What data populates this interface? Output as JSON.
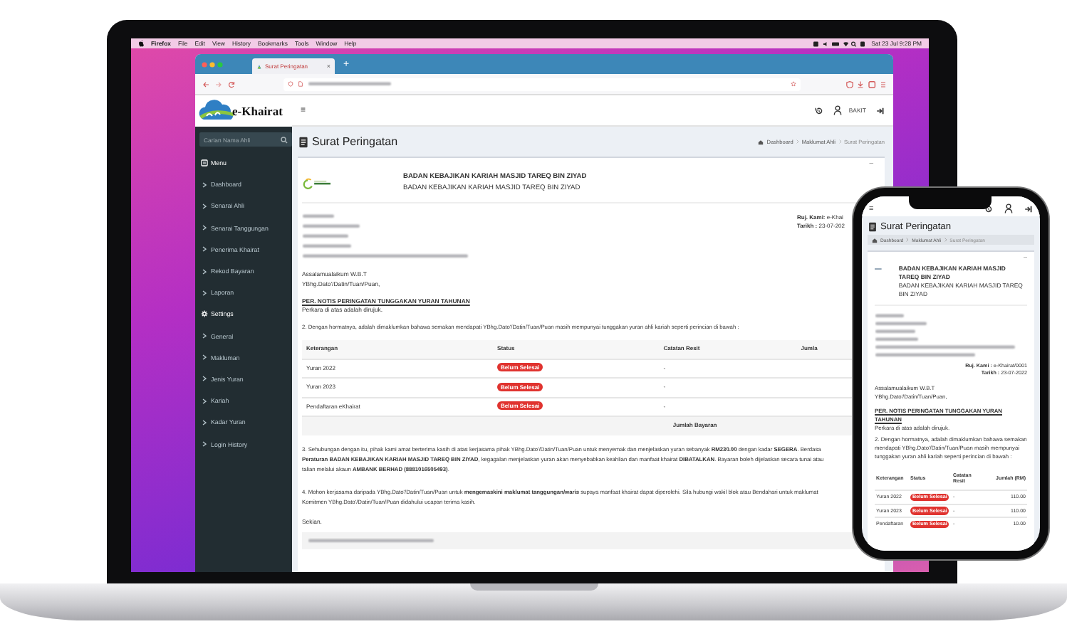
{
  "laptop": {
    "menu_bar": {
      "app": "Firefox",
      "menus": [
        "File",
        "Edit",
        "View",
        "History",
        "Bookmarks",
        "Tools",
        "Window",
        "Help"
      ],
      "clock": "Sat 23 Jul 9:28 PM"
    },
    "browser": {
      "tabs": [
        {
          "label": "Surat Peringatan",
          "selected": true
        }
      ],
      "close_tab": "×",
      "new_tab": "+"
    },
    "app": {
      "logo": "e-Khairat",
      "menu_toggle": "≡",
      "user": "BAKIT",
      "sidebar": {
        "search": {
          "placeholder": "Carian Nama Ahli"
        },
        "items": [
          {
            "kind": "section",
            "label": "Menu"
          },
          {
            "kind": "link",
            "label": "Dashboard"
          },
          {
            "kind": "link",
            "label": "Senarai Ahli"
          },
          {
            "kind": "link",
            "label": "Senarai Tanggungan"
          },
          {
            "kind": "link",
            "label": "Penerima Khairat"
          },
          {
            "kind": "link",
            "label": "Rekod Bayaran"
          },
          {
            "kind": "link",
            "label": "Laporan"
          },
          {
            "kind": "section",
            "label": "Settings"
          },
          {
            "kind": "link",
            "label": "General"
          },
          {
            "kind": "link",
            "label": "Makluman"
          },
          {
            "kind": "link",
            "label": "Jenis Yuran"
          },
          {
            "kind": "link",
            "label": "Kariah"
          },
          {
            "kind": "link",
            "label": "Kadar Yuran"
          },
          {
            "kind": "link",
            "label": "Login History"
          }
        ]
      },
      "page_title": "Surat Peringatan",
      "breadcrumb": [
        "Dashboard",
        "Maklumat Ahli",
        "Surat Peringatan"
      ],
      "collapse": "–",
      "letter": {
        "org_name": "BADAN KEBAJIKAN KARIAH MASJID TAREQ BIN ZIYAD",
        "org_subtitle": "BADAN KEBAJIKAN KARIAH MASJID TAREQ BIN ZIYAD",
        "references": [
          {
            "label": "Ruj. Kami:",
            "value": "e-Khai"
          },
          {
            "label": "Tarikh :",
            "value": "23-07-202"
          }
        ],
        "greeting": [
          "Assalamualaikum W.B.T",
          "YBhg.Dato'/Datin/Tuan/Puan,"
        ],
        "subject": "PER. NOTIS PERINGATAN TUNGGAKAN YURAN TAHUNAN",
        "intro": "Perkara di atas adalah dirujuk.",
        "paragraph_2": [
          "2.  Dengan hormatnya, adalah dimaklumkan bahawa semakan mendapati YBhg.Dato'/Datin/Tuan/Puan masih mempunyai tunggakan yuran ahli kariah seperti perincian di bawah :"
        ],
        "table": {
          "columns": [
            "Keterangan",
            "Status",
            "Catatan Resit",
            "Jumla"
          ],
          "rows": [
            {
              "item": "Yuran 2022",
              "status": "Belum Selesai",
              "note": "-"
            },
            {
              "item": "Yuran 2023",
              "status": "Belum Selesai",
              "note": "-"
            },
            {
              "item": "Pendaftaran eKhairat",
              "status": "Belum Selesai",
              "note": "-"
            }
          ],
          "total_label": "Jumlah Bayaran"
        },
        "paragraph_3": [
          "3.  Sehubungan dengan itu, pihak kami amat berterima kasih di atas kerjasama pihak YBhg.Dato'/Datin/Tuan/Puan untuk menyemak dan menjelaskan yuran sebanyak **RM230.00** dengan kadar **SEGERA**. Berdasa",
          "**Peraturan BADAN KEBAJIKAN KARIAH MASJID TAREQ BIN ZIYAD**, kegagalan menjelaskan yuran akan menyebabkan keahlian dan manfaat khairat **DIBATALKAN**. Bayaran boleh dijelaskan secara tunai atau",
          "talian melalui akaun **AMBANK BERHAD (8881016505493)**."
        ],
        "paragraph_4": [
          "4.  Mohon kerjasama daripada YBhg.Dato'/Datin/Tuan/Puan untuk **mengemaskini maklumat tanggungan/waris** supaya manfaat khairat dapat diperolehi. Sila hubungi wakil blok atau Bendahari untuk maklumat",
          "Komitmen YBhg.Dato'/Datin/Tuan/Puan didahului ucapan terima kasih."
        ],
        "closing": "Sekian."
      }
    }
  },
  "phone": {
    "menu_toggle": "≡",
    "page_title": "Surat Peringatan",
    "breadcrumb": [
      "Dashboard",
      "Maklumat Ahli",
      "Surat Peringatan"
    ],
    "collapse": "–",
    "letter": {
      "org_name": "BADAN KEBAJIKAN KARIAH MASJID TAREQ BIN ZIYAD",
      "org_subtitle": "BADAN KEBAJIKAN KARIAH MASJID TAREQ BIN ZIYAD",
      "references": [
        {
          "label": "Ruj. Kami :",
          "value": "e-Khairat/0001"
        },
        {
          "label": "Tarikh :",
          "value": "23-07-2022"
        }
      ],
      "greeting": [
        "Assalamualaikum W.B.T",
        "YBhg.Dato'/Datin/Tuan/Puan,"
      ],
      "subject": "PER. NOTIS PERINGATAN TUNGGAKAN YURAN TAHUNAN",
      "intro": "Perkara di atas adalah dirujuk.",
      "paragraph_2": "2.  Dengan hormatnya, adalah dimaklumkan bahawa semakan mendapati YBhg.Dato'/Datin/Tuan/Puan masih mempunyai tunggakan yuran ahli kariah seperti perincian di bawah :",
      "table": {
        "columns": [
          "Keterangan",
          "Status",
          "Catatan Resit",
          "Jumlah (RM)"
        ],
        "rows": [
          {
            "item": "Yuran 2022",
            "status": "Belum Selesai",
            "note": "-",
            "amount": "110.00"
          },
          {
            "item": "Yuran 2023",
            "status": "Belum Selesai",
            "note": "-",
            "amount": "110.00"
          },
          {
            "item": "Pendaftaran",
            "status": "Belum Selesai",
            "note": "-",
            "amount": "10.00"
          }
        ]
      }
    }
  }
}
